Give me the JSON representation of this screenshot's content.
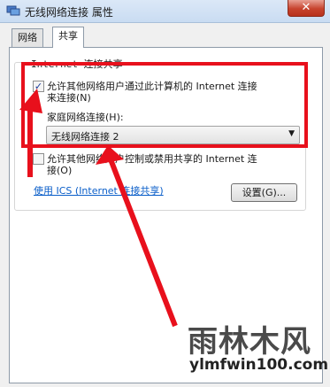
{
  "window": {
    "title": "无线网络连接 属性",
    "close_glyph": "✕"
  },
  "tabs": [
    {
      "label": "网络",
      "active": false
    },
    {
      "label": "共享",
      "active": true
    }
  ],
  "group": {
    "title": "Internet 连接共享"
  },
  "allow_share": {
    "checked": true,
    "check_glyph": "✓",
    "label_line1": "允许其他网络用户通过此计算机的 Internet 连接",
    "label_line2": "来连接(N)"
  },
  "home_connection": {
    "label": "家庭网络连接(H):",
    "value": "无线网络连接 2",
    "arrow_glyph": "▼"
  },
  "allow_control": {
    "checked": false,
    "label_line1": "允许其他网络用户控制或禁用共享的 Internet 连",
    "label_line2": "接(O)"
  },
  "ics_link": "使用 ICS (Internet 连接共享)",
  "settings_button": "设置(G)...",
  "annotation_color": "#e8101c",
  "watermark": {
    "text": "雨林木风",
    "url": "ylmfwin100.com"
  }
}
